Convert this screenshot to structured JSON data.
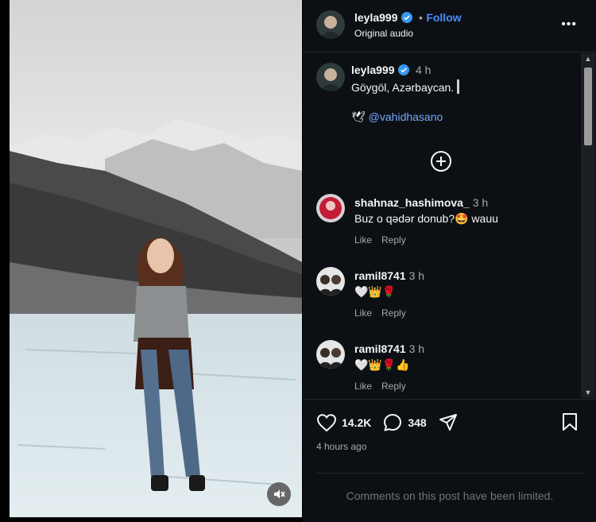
{
  "header": {
    "username": "leyla999",
    "separator": "•",
    "follow_label": "Follow",
    "audio": "Original audio",
    "more_icon": "more-options-icon"
  },
  "caption": {
    "username": "leyla999",
    "time": "4 h",
    "text": "Göygöl, Azərbaycan.",
    "mention_emoji": "🕊",
    "mention": "@vahidhasano"
  },
  "comments": [
    {
      "username": "shahnaz_hashimova_",
      "time": "3 h",
      "text": "Buz o qədər donub?🤩 wauu",
      "like": "Like",
      "reply": "Reply"
    },
    {
      "username": "ramil8741",
      "time": "3 h",
      "text": "🤍👑🌹",
      "like": "Like",
      "reply": "Reply"
    },
    {
      "username": "ramil8741",
      "time": "3 h",
      "text": "🤍👑🌹👍",
      "like": "Like",
      "reply": "Reply"
    }
  ],
  "actions": {
    "likes": "14.2K",
    "comments": "348"
  },
  "timestamp": "4 hours ago",
  "limited_notice": "Comments on this post have been limited.",
  "colors": {
    "panel_bg": "#0c1014",
    "link": "#4a8ef5",
    "verified": "#3897f0"
  }
}
